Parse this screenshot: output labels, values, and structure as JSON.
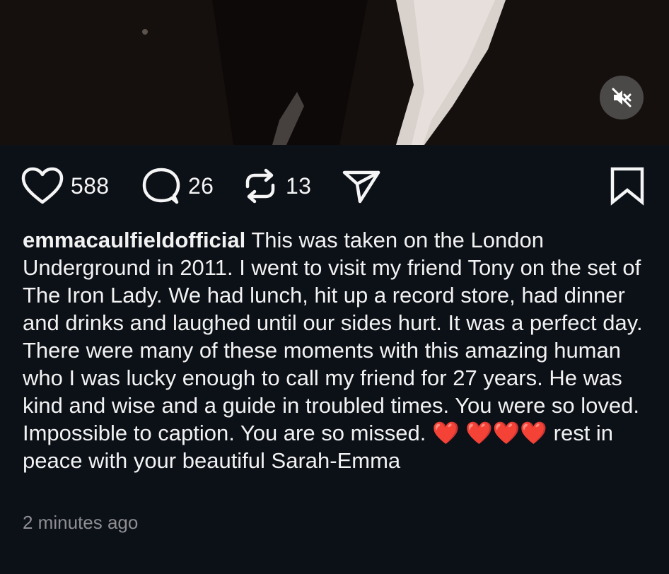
{
  "post": {
    "username": "emmacaulfieldofficial",
    "caption_text": " This was taken on the London Underground in 2011. I went to visit my friend Tony on the set of The Iron Lady. We had lunch, hit up a record store, had dinner and drinks and laughed until our sides hurt. It was a perfect day. There were many of these moments with this amazing human who I was lucky enough to call my friend for 27 years. He was kind and wise and a guide in troubled times. You were so loved. Impossible to caption. You are so missed. ",
    "caption_emojis": "❤️ ❤️❤️❤️",
    "caption_end": " rest in peace with your beautiful Sarah-Emma",
    "timestamp": "2 minutes ago"
  },
  "actions": {
    "likes": "588",
    "comments": "26",
    "reposts": "13"
  },
  "icons": {
    "like": "heart-icon",
    "comment": "speech-bubble-icon",
    "repost": "repost-icon",
    "share": "paper-plane-icon",
    "bookmark": "bookmark-icon",
    "mute": "muted-speaker-icon"
  },
  "colors": {
    "background": "#0c1017",
    "text": "#f5f5f5",
    "muted_text": "#8e8e93",
    "heart_emoji": "#e0102a"
  }
}
